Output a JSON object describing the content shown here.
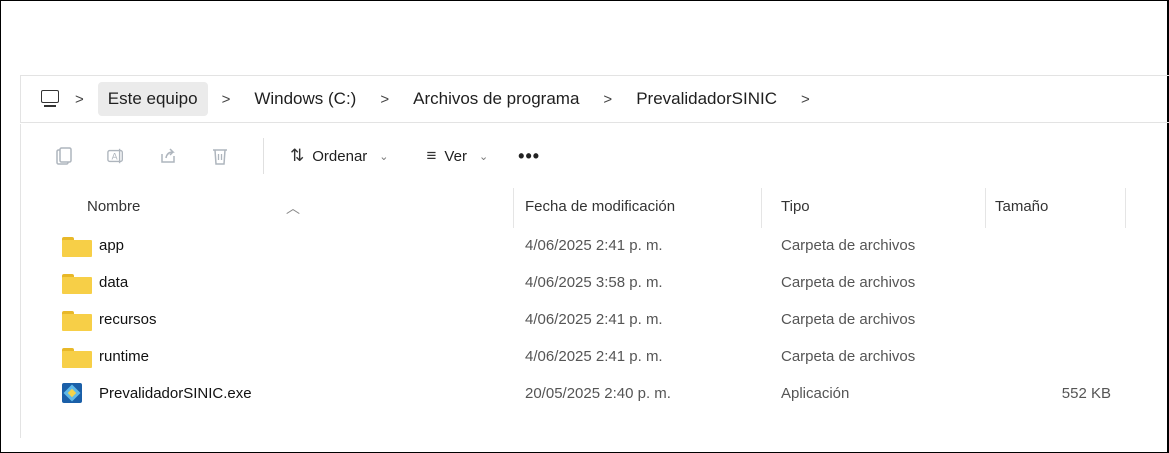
{
  "address": {
    "crumbs": [
      "Este equipo",
      "Windows (C:)",
      "Archivos de programa",
      "PrevalidadorSINIC"
    ],
    "separator": ">"
  },
  "toolbar": {
    "sort_label": "Ordenar",
    "view_label": "Ver",
    "more_label": "•••"
  },
  "columns": {
    "name": "Nombre",
    "date": "Fecha de modificación",
    "type": "Tipo",
    "size": "Tamaño"
  },
  "files": [
    {
      "name": "app",
      "date": "4/06/2025 2:41 p. m.",
      "type": "Carpeta de archivos",
      "size": "",
      "icon": "folder-icon"
    },
    {
      "name": "data",
      "date": "4/06/2025 3:58 p. m.",
      "type": "Carpeta de archivos",
      "size": "",
      "icon": "folder-icon"
    },
    {
      "name": "recursos",
      "date": "4/06/2025 2:41 p. m.",
      "type": "Carpeta de archivos",
      "size": "",
      "icon": "folder-icon"
    },
    {
      "name": "runtime",
      "date": "4/06/2025 2:41 p. m.",
      "type": "Carpeta de archivos",
      "size": "",
      "icon": "folder-icon"
    },
    {
      "name": "PrevalidadorSINIC.exe",
      "date": "20/05/2025 2:40 p. m.",
      "type": "Aplicación",
      "size": "552 KB",
      "icon": "application-icon"
    }
  ],
  "colors": {
    "folder": "#f7cf47",
    "active_crumb_bg": "#ebebeb",
    "disabled_icon": "#aeb5bd"
  }
}
